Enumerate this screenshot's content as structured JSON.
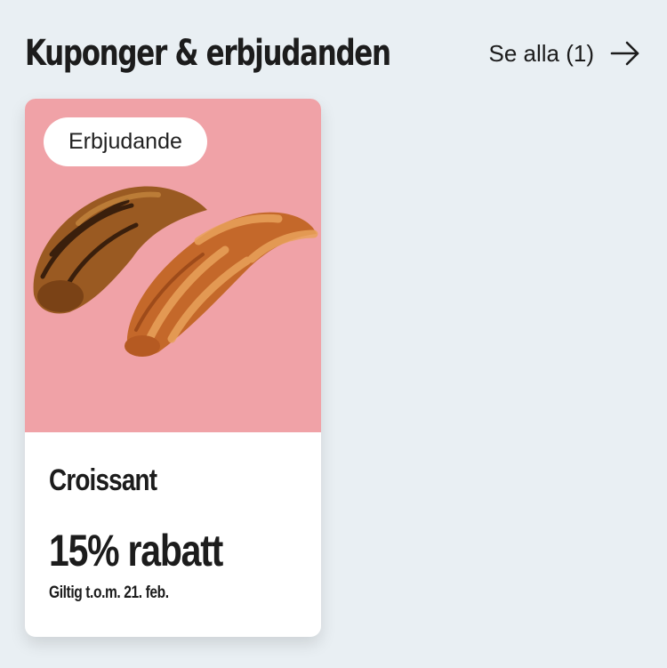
{
  "header": {
    "title": "Kuponger & erbjudanden",
    "see_all_label": "Se alla (1)",
    "arrow_icon": "arrow-right-icon"
  },
  "coupons": [
    {
      "badge": "Erbjudande",
      "image": "croissant-image",
      "name": "Croissant",
      "discount": "15% rabatt",
      "validity": "Giltig t.o.m. 21. feb.",
      "image_bg": "#f0a2a7"
    }
  ]
}
